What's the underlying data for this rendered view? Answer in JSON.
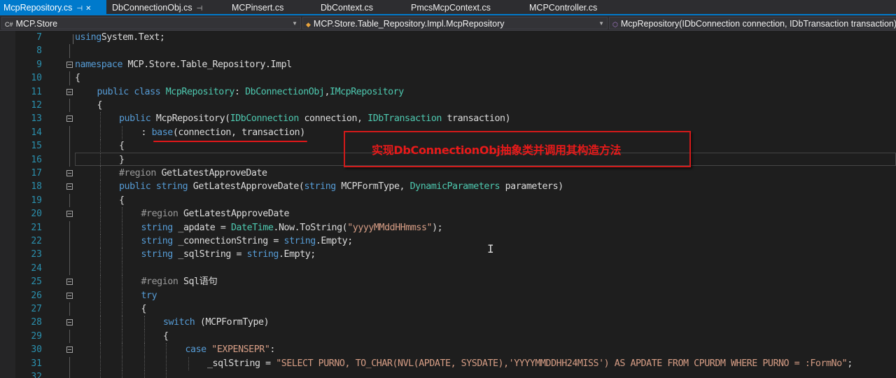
{
  "tabs": [
    {
      "label": "McpRepository.cs",
      "active": true,
      "pinned": true
    },
    {
      "label": "DbConnectionObj.cs",
      "active": false,
      "pinned": true
    },
    {
      "label": "MCPinsert.cs",
      "active": false,
      "pinned": false
    },
    {
      "label": "DbContext.cs",
      "active": false,
      "pinned": false
    },
    {
      "label": "PmcsMcpContext.cs",
      "active": false,
      "pinned": false
    },
    {
      "label": "MCPController.cs",
      "active": false,
      "pinned": false
    }
  ],
  "nav": {
    "project": "MCP.Store",
    "type": "MCP.Store.Table_Repository.Impl.McpRepository",
    "member": "McpRepository(IDbConnection connection, IDbTransaction transaction)"
  },
  "lines": [
    {
      "n": "7",
      "fold": false,
      "indent": 0,
      "tokens": [
        [
          "kw",
          "using"
        ],
        [
          "",
          "System.Text;"
        ]
      ]
    },
    {
      "n": "8",
      "fold": false,
      "indent": 0,
      "tokens": []
    },
    {
      "n": "9",
      "fold": true,
      "indent": 0,
      "tokens": [
        [
          "kw",
          "namespace"
        ],
        [
          "",
          " MCP.Store.Table_Repository.Impl"
        ]
      ]
    },
    {
      "n": "10",
      "fold": false,
      "indent": 0,
      "tokens": [
        [
          "",
          "{"
        ]
      ]
    },
    {
      "n": "11",
      "fold": true,
      "indent": 1,
      "tokens": [
        [
          "kw",
          "public"
        ],
        [
          "",
          " "
        ],
        [
          "kw",
          "class"
        ],
        [
          "",
          " "
        ],
        [
          "ty",
          "McpRepository"
        ],
        [
          "",
          ": "
        ],
        [
          "ty",
          "DbConnectionObj"
        ],
        [
          "",
          ","
        ],
        [
          "ty",
          "IMcpRepository"
        ]
      ]
    },
    {
      "n": "12",
      "fold": false,
      "indent": 1,
      "tokens": [
        [
          "",
          "{"
        ]
      ]
    },
    {
      "n": "13",
      "fold": true,
      "indent": 2,
      "tokens": [
        [
          "kw",
          "public"
        ],
        [
          "",
          " McpRepository("
        ],
        [
          "ty",
          "IDbConnection"
        ],
        [
          "",
          " connection, "
        ],
        [
          "ty",
          "IDbTransaction"
        ],
        [
          "",
          " transaction)"
        ]
      ]
    },
    {
      "n": "14",
      "fold": false,
      "indent": 3,
      "tokens": [
        [
          "",
          ": "
        ],
        [
          "kw",
          "base"
        ],
        [
          "",
          "(connection, transaction)"
        ]
      ]
    },
    {
      "n": "15",
      "fold": false,
      "indent": 2,
      "tokens": [
        [
          "",
          "{"
        ]
      ]
    },
    {
      "n": "16",
      "fold": false,
      "indent": 2,
      "tokens": [
        [
          "",
          "}"
        ]
      ]
    },
    {
      "n": "17",
      "fold": true,
      "indent": 2,
      "tokens": [
        [
          "pre",
          "#region"
        ],
        [
          "",
          " GetLatestApproveDate"
        ]
      ]
    },
    {
      "n": "18",
      "fold": true,
      "indent": 2,
      "tokens": [
        [
          "kw",
          "public"
        ],
        [
          "",
          " "
        ],
        [
          "kw",
          "string"
        ],
        [
          "",
          " GetLatestApproveDate("
        ],
        [
          "kw",
          "string"
        ],
        [
          "",
          " MCPFormType, "
        ],
        [
          "ty",
          "DynamicParameters"
        ],
        [
          "",
          " parameters)"
        ]
      ]
    },
    {
      "n": "19",
      "fold": false,
      "indent": 2,
      "tokens": [
        [
          "",
          "{"
        ]
      ]
    },
    {
      "n": "20",
      "fold": true,
      "indent": 3,
      "tokens": [
        [
          "pre",
          "#region"
        ],
        [
          "",
          " GetLatestApproveDate"
        ]
      ]
    },
    {
      "n": "21",
      "fold": false,
      "indent": 3,
      "tokens": [
        [
          "kw",
          "string"
        ],
        [
          "",
          " _apdate = "
        ],
        [
          "ty",
          "DateTime"
        ],
        [
          "",
          ".Now.ToString("
        ],
        [
          "str",
          "\"yyyyMMddHHmmss\""
        ],
        [
          "",
          ");"
        ]
      ]
    },
    {
      "n": "22",
      "fold": false,
      "indent": 3,
      "tokens": [
        [
          "kw",
          "string"
        ],
        [
          "",
          " _connectionString = "
        ],
        [
          "kw",
          "string"
        ],
        [
          "",
          ".Empty;"
        ]
      ]
    },
    {
      "n": "23",
      "fold": false,
      "indent": 3,
      "tokens": [
        [
          "kw",
          "string"
        ],
        [
          "",
          " _sqlString = "
        ],
        [
          "kw",
          "string"
        ],
        [
          "",
          ".Empty;"
        ]
      ]
    },
    {
      "n": "24",
      "fold": false,
      "indent": 3,
      "tokens": []
    },
    {
      "n": "25",
      "fold": true,
      "indent": 3,
      "tokens": [
        [
          "pre",
          "#region"
        ],
        [
          "",
          " Sql语句"
        ]
      ]
    },
    {
      "n": "26",
      "fold": true,
      "indent": 3,
      "tokens": [
        [
          "kw",
          "try"
        ]
      ]
    },
    {
      "n": "27",
      "fold": false,
      "indent": 3,
      "tokens": [
        [
          "",
          "{"
        ]
      ]
    },
    {
      "n": "28",
      "fold": true,
      "indent": 4,
      "tokens": [
        [
          "kw",
          "switch"
        ],
        [
          "",
          " (MCPFormType)"
        ]
      ]
    },
    {
      "n": "29",
      "fold": false,
      "indent": 4,
      "tokens": [
        [
          "",
          "{"
        ]
      ]
    },
    {
      "n": "30",
      "fold": true,
      "indent": 5,
      "tokens": [
        [
          "kw",
          "case"
        ],
        [
          "",
          " "
        ],
        [
          "str",
          "\"EXPENSEPR\""
        ],
        [
          "",
          ":"
        ]
      ]
    },
    {
      "n": "31",
      "fold": false,
      "indent": 6,
      "tokens": [
        [
          "",
          "_sqlString = "
        ],
        [
          "str",
          "\"SELECT PURNO, TO_CHAR(NVL(APDATE, SYSDATE),'YYYYMMDDHH24MISS') AS APDATE FROM CPURDM WHERE PURNO = :FormNo\""
        ],
        [
          "",
          ";"
        ]
      ]
    },
    {
      "n": "32",
      "fold": false,
      "indent": 5,
      "tokens": []
    }
  ],
  "annotation": {
    "text": "实现DbConnectionObj抽象类并调用其构造方法",
    "color": "#e81a1a"
  },
  "colors": {
    "accent": "#007acc",
    "keyword": "#569cd6",
    "type": "#4ec9b0",
    "string": "#d69d85",
    "line_number": "#2b91af"
  }
}
